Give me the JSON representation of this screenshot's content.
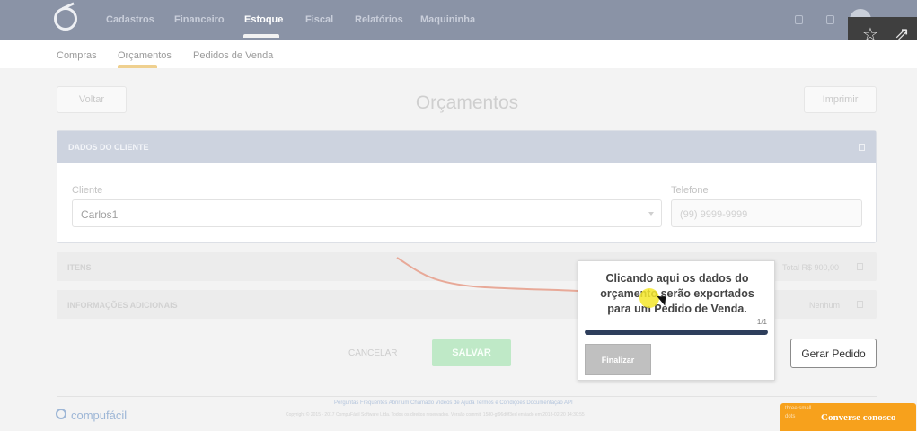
{
  "navbar": {
    "items": [
      "Cadastros",
      "Financeiro",
      "Estoque",
      "Fiscal",
      "Relatórios",
      "Maquininha"
    ],
    "active": "Estoque",
    "icons": [
      "logo-icon",
      "notification-icon",
      "help-icon",
      "avatar",
      "star-icon",
      "share-icon"
    ]
  },
  "subnav": {
    "items": [
      "Compras",
      "Orçamentos",
      "Pedidos de Venda"
    ],
    "active": "Orçamentos"
  },
  "header": {
    "back_label": "Voltar",
    "title": "Orçamentos",
    "print_label": "Imprimir"
  },
  "client_panel": {
    "title": "DADOS DO CLIENTE",
    "client_label": "Cliente",
    "client_value": "Carlos1",
    "phone_label": "Telefone",
    "phone_placeholder": "(99) 9999-9999"
  },
  "items_bar": {
    "label": "ITENS",
    "total": "Total R$ 900,00"
  },
  "info_bar": {
    "label": "INFORMAÇÕES ADICIONAIS",
    "value": "Nenhum"
  },
  "actions": {
    "cancel_label": "CANCELAR",
    "save_label": "SALVAR",
    "gerar_label": "Gerar Pedido"
  },
  "tooltip": {
    "text": "Clicando aqui os dados do orçamento serão exportados para um Pedido de Venda.",
    "counter": "1/1",
    "progress": 1.0,
    "finish_label": "Finalizar"
  },
  "footer": {
    "brand": "compufácil",
    "links": "Perguntas Frequentes   Abrir um Chamado   Vídeos de Ajuda   Termos e Condições   Documentação API",
    "copyright": "Copyright © 2015 - 2017 CompuFácil Software Ltda. Todos os direitos reservados. Versão commit: 1580-gf96d0f3ed enviado em 2018-02-20 14:30:55",
    "chat_dots": "three small dots",
    "chat_label": "Converse conosco"
  },
  "colors": {
    "navbar": "#8a93a6",
    "accent_underline": "#efd08f",
    "progress": "#2e3e5c",
    "chat": "#f7a11c",
    "save": "#bfe9c7"
  }
}
